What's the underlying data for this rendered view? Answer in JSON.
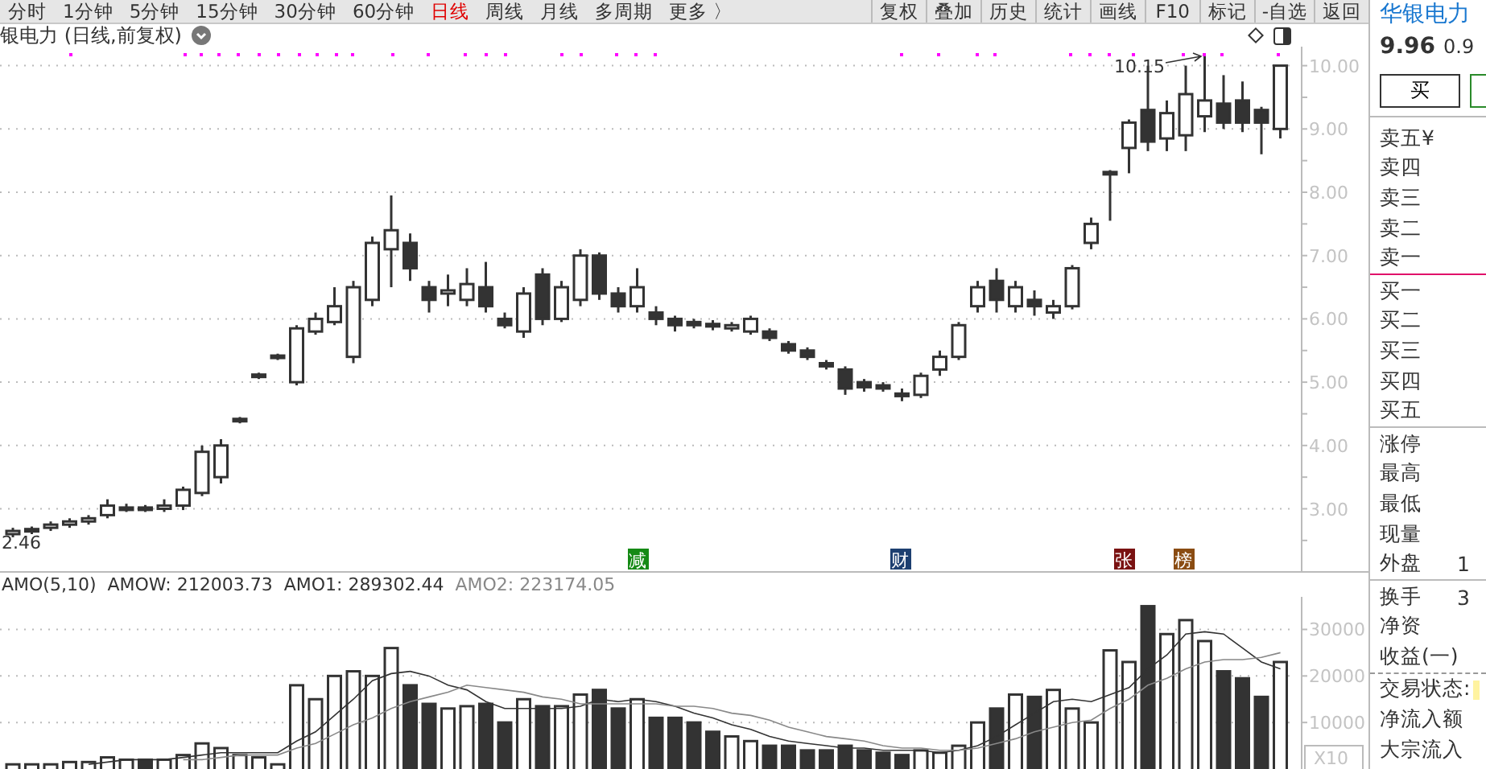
{
  "toolbar": {
    "period_tabs": [
      {
        "label": "分时",
        "selected": false
      },
      {
        "label": "1分钟",
        "selected": false
      },
      {
        "label": "5分钟",
        "selected": false
      },
      {
        "label": "15分钟",
        "selected": false
      },
      {
        "label": "30分钟",
        "selected": false
      },
      {
        "label": "60分钟",
        "selected": false
      },
      {
        "label": "日线",
        "selected": true
      },
      {
        "label": "周线",
        "selected": false
      },
      {
        "label": "月线",
        "selected": false
      },
      {
        "label": "多周期",
        "selected": false
      },
      {
        "label": "更多 〉",
        "selected": false
      }
    ],
    "tools": [
      "复权",
      "叠加",
      "历史",
      "统计",
      "画线",
      "F10",
      "标记",
      "-自选",
      "返回"
    ]
  },
  "chart": {
    "title": "银电力 (日线,前复权)",
    "high_label": "10.15",
    "low_label": "2.46",
    "events": [
      {
        "label": "减",
        "color": "#158a15"
      },
      {
        "label": "财",
        "color": "#1d3f70"
      },
      {
        "label": "张",
        "color": "#7a1212"
      },
      {
        "label": "榜",
        "color": "#8a4c12"
      }
    ],
    "chart_data": {
      "type": "candlestick",
      "grid": true,
      "ylim": [
        1.99,
        10.3
      ],
      "yticks": [
        {
          "value": 10,
          "label": "10.00"
        },
        {
          "value": 9,
          "label": "9.00"
        },
        {
          "value": 8,
          "label": "8.00"
        },
        {
          "value": 7,
          "label": "7.00"
        },
        {
          "value": 6,
          "label": "6.00"
        },
        {
          "value": 5,
          "label": "5.00"
        },
        {
          "value": 4,
          "label": "4.00"
        },
        {
          "value": 3,
          "label": "3.00"
        }
      ],
      "ohlc": [
        [
          2.6,
          2.7,
          2.55,
          2.65
        ],
        [
          2.65,
          2.72,
          2.6,
          2.68
        ],
        [
          2.7,
          2.8,
          2.65,
          2.75
        ],
        [
          2.75,
          2.85,
          2.7,
          2.8
        ],
        [
          2.8,
          2.9,
          2.75,
          2.85
        ],
        [
          2.9,
          3.15,
          2.85,
          3.05
        ],
        [
          3.0,
          3.08,
          2.95,
          3.02
        ],
        [
          3.02,
          3.06,
          2.95,
          3.0
        ],
        [
          3.0,
          3.15,
          2.95,
          3.05
        ],
        [
          3.05,
          3.35,
          2.98,
          3.3
        ],
        [
          3.25,
          4.0,
          3.2,
          3.9
        ],
        [
          3.5,
          4.1,
          3.4,
          4.0
        ],
        [
          4.4,
          4.45,
          4.35,
          4.42
        ],
        [
          5.1,
          5.15,
          5.05,
          5.12
        ],
        [
          5.4,
          5.45,
          5.35,
          5.42
        ],
        [
          5.0,
          5.9,
          4.95,
          5.85
        ],
        [
          5.8,
          6.1,
          5.75,
          6.0
        ],
        [
          5.95,
          6.5,
          5.9,
          6.2
        ],
        [
          5.4,
          6.6,
          5.3,
          6.5
        ],
        [
          6.3,
          7.3,
          6.2,
          7.2
        ],
        [
          7.1,
          7.95,
          6.5,
          7.4
        ],
        [
          7.2,
          7.35,
          6.6,
          6.8
        ],
        [
          6.5,
          6.6,
          6.1,
          6.3
        ],
        [
          6.4,
          6.7,
          6.2,
          6.45
        ],
        [
          6.3,
          6.8,
          6.2,
          6.55
        ],
        [
          6.5,
          6.9,
          6.1,
          6.2
        ],
        [
          6.0,
          6.1,
          5.85,
          5.9
        ],
        [
          5.8,
          6.5,
          5.7,
          6.4
        ],
        [
          6.7,
          6.8,
          5.9,
          6.0
        ],
        [
          6.0,
          6.6,
          5.95,
          6.5
        ],
        [
          6.3,
          7.1,
          6.2,
          7.0
        ],
        [
          7.0,
          7.05,
          6.3,
          6.4
        ],
        [
          6.4,
          6.5,
          6.1,
          6.2
        ],
        [
          6.2,
          6.8,
          6.1,
          6.5
        ],
        [
          6.1,
          6.2,
          5.9,
          6.0
        ],
        [
          6.0,
          6.05,
          5.8,
          5.9
        ],
        [
          5.95,
          6.0,
          5.85,
          5.9
        ],
        [
          5.92,
          5.98,
          5.82,
          5.88
        ],
        [
          5.85,
          5.95,
          5.8,
          5.9
        ],
        [
          5.8,
          6.05,
          5.75,
          6.0
        ],
        [
          5.8,
          5.85,
          5.65,
          5.7
        ],
        [
          5.6,
          5.65,
          5.45,
          5.5
        ],
        [
          5.5,
          5.55,
          5.35,
          5.4
        ],
        [
          5.3,
          5.35,
          5.2,
          5.25
        ],
        [
          5.2,
          5.25,
          4.8,
          4.9
        ],
        [
          5.0,
          5.05,
          4.85,
          4.92
        ],
        [
          4.95,
          5.0,
          4.85,
          4.9
        ],
        [
          4.82,
          4.9,
          4.7,
          4.78
        ],
        [
          4.8,
          5.15,
          4.75,
          5.1
        ],
        [
          5.2,
          5.5,
          5.1,
          5.4
        ],
        [
          5.4,
          5.95,
          5.35,
          5.9
        ],
        [
          6.2,
          6.6,
          6.1,
          6.5
        ],
        [
          6.6,
          6.8,
          6.1,
          6.3
        ],
        [
          6.2,
          6.6,
          6.1,
          6.5
        ],
        [
          6.3,
          6.45,
          6.05,
          6.2
        ],
        [
          6.1,
          6.3,
          6.0,
          6.2
        ],
        [
          6.2,
          6.85,
          6.15,
          6.8
        ],
        [
          7.2,
          7.6,
          7.1,
          7.5
        ],
        [
          8.3,
          8.35,
          7.55,
          8.32
        ],
        [
          8.7,
          9.15,
          8.3,
          9.1
        ],
        [
          9.3,
          10.0,
          8.65,
          8.8
        ],
        [
          8.85,
          9.45,
          8.65,
          9.25
        ],
        [
          8.9,
          10.0,
          8.65,
          9.55
        ],
        [
          9.2,
          10.15,
          8.95,
          9.45
        ],
        [
          9.4,
          9.85,
          9.0,
          9.1
        ],
        [
          9.45,
          9.75,
          8.95,
          9.1
        ],
        [
          9.3,
          9.35,
          8.6,
          9.1
        ],
        [
          9.0,
          10.0,
          8.85,
          10.0
        ]
      ]
    }
  },
  "indicator": {
    "name": "AMO(5,10)",
    "values": [
      {
        "label": "AMOW: 212003.73",
        "kind": "main"
      },
      {
        "label": "AMO1: 289302.44",
        "kind": "main"
      },
      {
        "label": "AMO2: 223174.05",
        "kind": "secondary"
      }
    ],
    "scale": "X10",
    "chart_data": {
      "type": "bar",
      "grid": true,
      "ylim": [
        0,
        37000
      ],
      "yticks": [
        {
          "value": 30000,
          "label": "30000"
        },
        {
          "value": 20000,
          "label": "20000"
        },
        {
          "value": 10000,
          "label": "10000"
        }
      ],
      "series": [
        {
          "color": "#333333",
          "values": [
            1000,
            1000,
            1000,
            1500,
            1500,
            2500,
            2000,
            2000,
            2000,
            3000,
            5500,
            4500,
            3000,
            2500,
            1000,
            18000,
            15000,
            20000,
            21000,
            20000,
            26000,
            18000,
            14000,
            13000,
            13500,
            14000,
            10000,
            15000,
            13500,
            13500,
            16000,
            17000,
            13000,
            15000,
            11000,
            11000,
            10000,
            8000,
            7000,
            6000,
            5000,
            5000,
            4000,
            4000,
            5000,
            4000,
            3500,
            3000,
            4000,
            3500,
            5000,
            10000,
            13000,
            16000,
            15500,
            17000,
            13000,
            10000,
            25500,
            23000,
            35000,
            29000,
            32000,
            27500,
            21000,
            19500,
            15500,
            23000
          ]
        },
        {
          "type": "line",
          "color": "#333333",
          "values": [
            null,
            null,
            null,
            null,
            1000,
            1500,
            2000,
            2000,
            2000,
            2500,
            3000,
            3500,
            3500,
            3500,
            3500,
            6000,
            8000,
            11500,
            15000,
            19000,
            20500,
            21000,
            20000,
            18000,
            17000,
            14500,
            13000,
            13000,
            13000,
            13000,
            13500,
            15000,
            14500,
            15000,
            14500,
            13500,
            12000,
            11000,
            9500,
            8500,
            7000,
            6000,
            5500,
            5000,
            4500,
            4500,
            4000,
            4000,
            4000,
            3500,
            4000,
            5000,
            7000,
            9500,
            12000,
            14500,
            15000,
            14500,
            16000,
            17500,
            21500,
            24500,
            29000,
            29500,
            29000,
            26000,
            23000,
            21500
          ]
        },
        {
          "type": "line",
          "color": "#888888",
          "values": [
            null,
            null,
            null,
            null,
            null,
            null,
            null,
            null,
            null,
            2000,
            2000,
            2500,
            3000,
            3000,
            3000,
            4500,
            5500,
            7500,
            9500,
            11000,
            13000,
            14500,
            15500,
            16500,
            18000,
            17500,
            17000,
            16500,
            15500,
            15000,
            14000,
            14000,
            14000,
            14000,
            14000,
            13500,
            13500,
            13000,
            12000,
            11500,
            10500,
            9000,
            8000,
            7000,
            6500,
            6000,
            5000,
            4500,
            4500,
            4000,
            4000,
            4500,
            5500,
            6500,
            8000,
            9000,
            10000,
            10500,
            13000,
            15000,
            18000,
            19500,
            21500,
            23000,
            23500,
            23500,
            24000,
            25000
          ]
        }
      ]
    }
  },
  "quote": {
    "name": "华银电力",
    "price": "9.96",
    "change": "0.9",
    "buy_button": "买",
    "ask_rows": [
      "卖五¥",
      "卖四",
      "卖三",
      "卖二",
      "卖一"
    ],
    "bid_rows": [
      "买一",
      "买二",
      "买三",
      "买四",
      "买五"
    ],
    "stats": [
      {
        "label": "涨停"
      },
      {
        "label": "最高"
      },
      {
        "label": "最低"
      },
      {
        "label": "现量"
      },
      {
        "label": "外盘",
        "value": "1"
      }
    ],
    "stats2": [
      {
        "label": "换手",
        "value": "3"
      },
      {
        "label": "净资"
      },
      {
        "label": "收益(一)"
      }
    ],
    "flow": [
      "交易状态:",
      "净流入额",
      "大宗流入"
    ]
  }
}
